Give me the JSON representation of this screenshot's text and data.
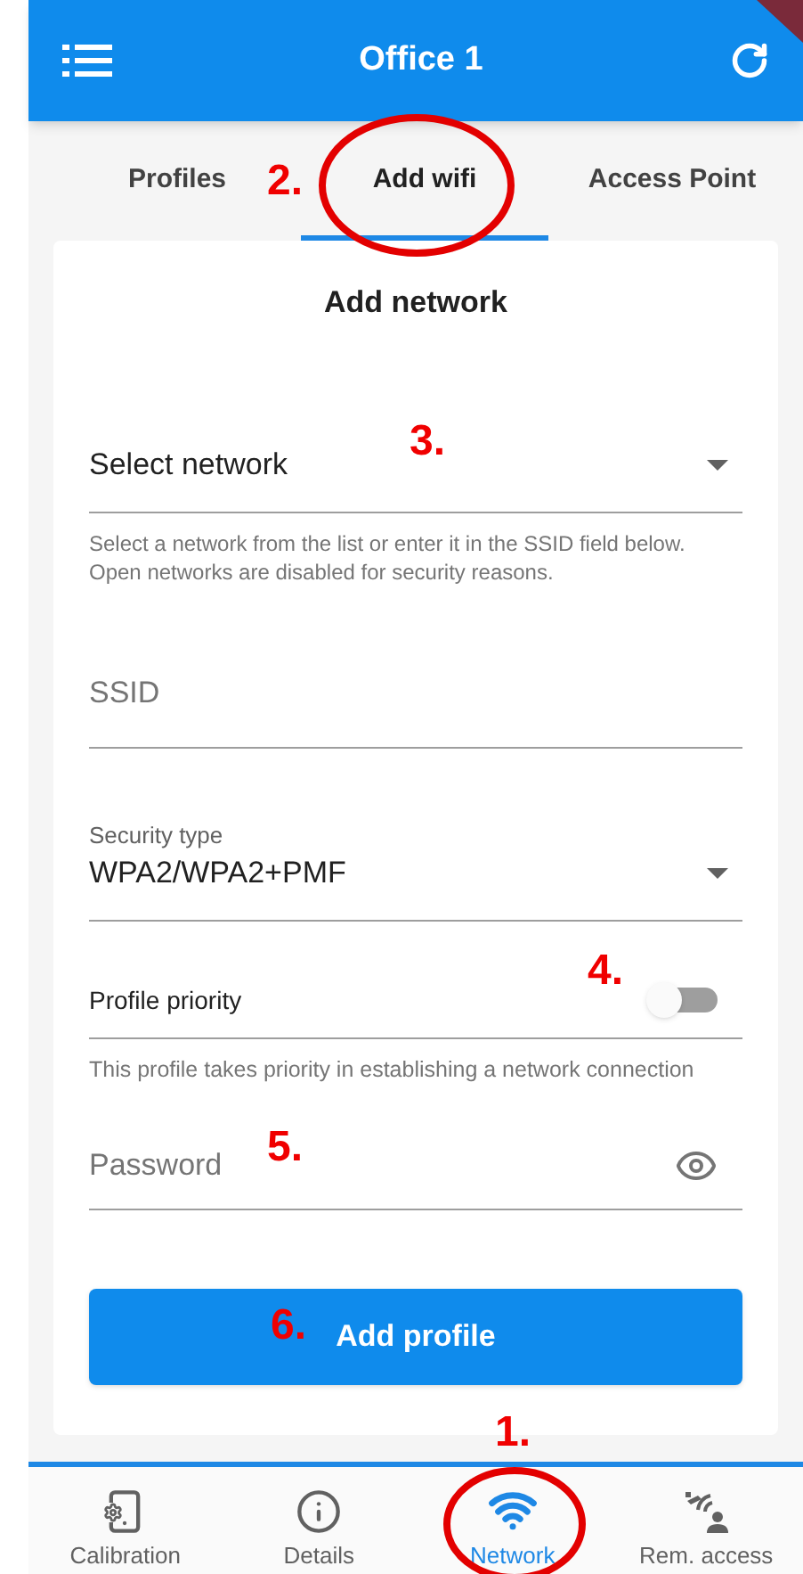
{
  "app_bar": {
    "title": "Office 1"
  },
  "tabs": [
    {
      "label": "Profiles",
      "selected": false
    },
    {
      "label": "Add wifi",
      "selected": true
    },
    {
      "label": "Access Point",
      "selected": false
    }
  ],
  "form": {
    "title": "Add network",
    "fields": [
      {
        "kind": "dropdown",
        "value": "Select network",
        "helper": "Select a network from the list or enter it in the SSID field below. Open networks are disabled for security reasons."
      },
      {
        "kind": "text",
        "placeholder": "SSID"
      },
      {
        "kind": "dropdown",
        "label": "Security type",
        "value": "WPA2/WPA2+PMF"
      },
      {
        "kind": "switch",
        "label": "Profile priority",
        "on": false,
        "helper": "This profile takes priority in establishing a network connection"
      },
      {
        "kind": "password",
        "placeholder": "Password"
      }
    ],
    "button": "Add profile"
  },
  "bottom_nav": [
    {
      "label": "Calibration",
      "selected": false
    },
    {
      "label": "Details",
      "selected": false
    },
    {
      "label": "Network",
      "selected": true
    },
    {
      "label": "Rem. access",
      "selected": false
    }
  ],
  "annotations": [
    {
      "label": "1."
    },
    {
      "label": "2."
    },
    {
      "label": "3."
    },
    {
      "label": "4."
    },
    {
      "label": "5."
    },
    {
      "label": "6."
    }
  ]
}
